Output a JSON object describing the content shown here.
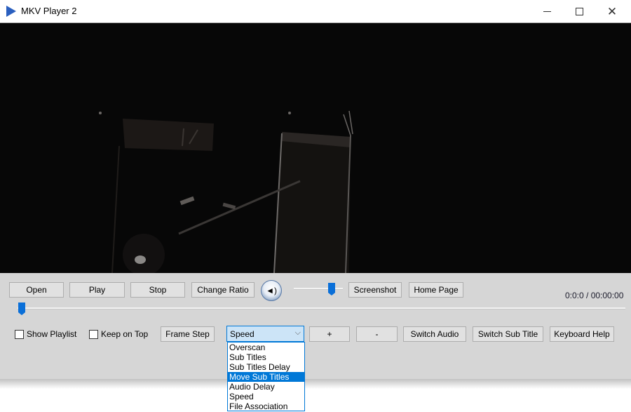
{
  "window": {
    "title": "MKV Player 2",
    "controls": {
      "minimize": "minimize-icon",
      "maximize": "maximize-icon",
      "close": "close-icon"
    }
  },
  "video": {
    "description": "dark video frame of a stage with a microphone stand"
  },
  "toolbar_row1": {
    "open": "Open",
    "play": "Play",
    "stop": "Stop",
    "change_ratio": "Change Ratio",
    "volume_icon": "speaker-icon",
    "volume_level_percent": 75,
    "screenshot": "Screenshot",
    "home_page": "Home Page"
  },
  "time": {
    "display": "0:0:0 / 00:00:00"
  },
  "seek": {
    "position_percent": 0
  },
  "toolbar_row2": {
    "show_playlist": {
      "label": "Show Playlist",
      "checked": false
    },
    "keep_on_top": {
      "label": "Keep on Top",
      "checked": false
    },
    "frame_step": "Frame Step",
    "mode_select": {
      "selected": "Speed",
      "options": [
        "Overscan",
        "Sub Titles",
        "Sub Titles Delay",
        "Move Sub Titles",
        "Audio Delay",
        "Speed",
        "File Association"
      ],
      "highlighted": "Move Sub Titles"
    },
    "plus": "+",
    "minus": "-",
    "switch_audio": "Switch Audio",
    "switch_sub_title": "Switch Sub Title",
    "keyboard_help": "Keyboard Help"
  },
  "colors": {
    "accent": "#0078d7",
    "panel": "#d6d6d6",
    "slider_thumb": "#0a6fd8"
  }
}
